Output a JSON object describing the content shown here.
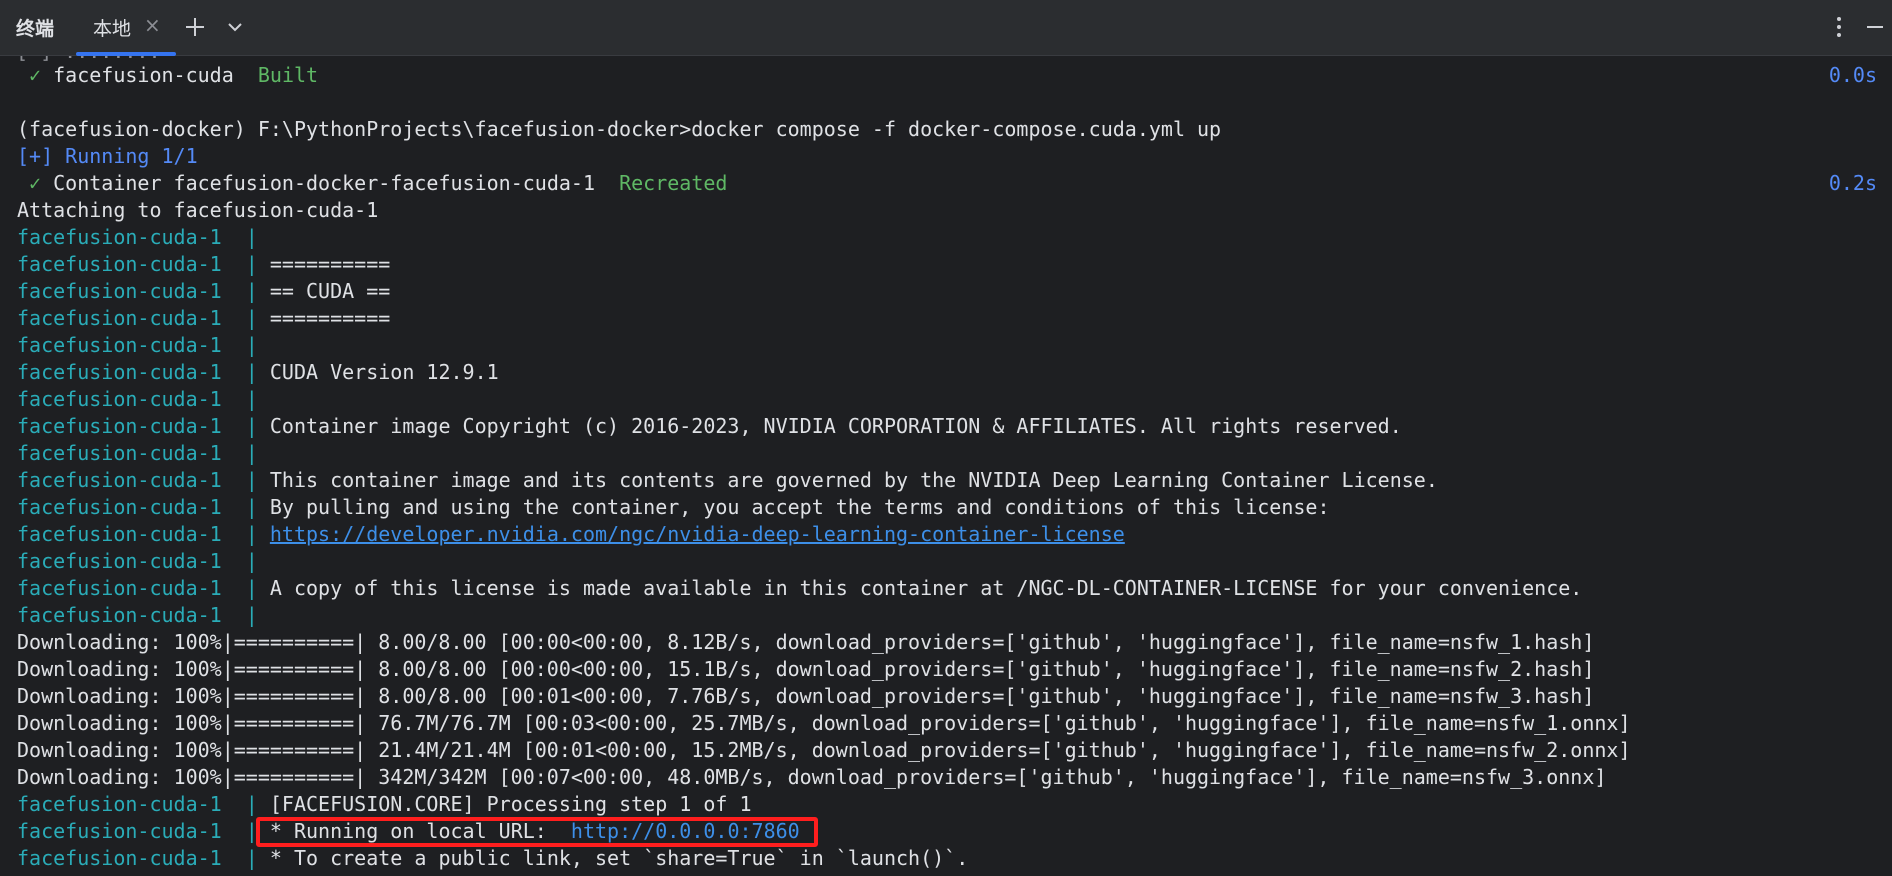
{
  "titlebar": {
    "panel_title": "终端",
    "tab_label": "本地",
    "tab_close": "×",
    "colors": {
      "accent": "#3574f0",
      "background": "#2b2d30"
    }
  },
  "terminal": {
    "cut_line": "[ ] ........ ",
    "built_line": {
      "check": "✓",
      "name": "facefusion-cuda",
      "status": "Built",
      "duration": "0.0s"
    },
    "blank1": "",
    "command": "(facefusion-docker) F:\\PythonProjects\\facefusion-docker>docker compose -f docker-compose.cuda.yml up",
    "running": "[+] Running 1/1",
    "recreated_line": {
      "check": "✓",
      "name": "Container facefusion-docker-facefusion-cuda-1",
      "status": "Recreated",
      "duration": "0.2s"
    },
    "attaching": "Attaching to facefusion-cuda-1",
    "prefix": "facefusion-cuda-1  | ",
    "log": [
      "",
      "==========",
      "== CUDA ==",
      "==========",
      "",
      "CUDA Version 12.9.1",
      "",
      "Container image Copyright (c) 2016-2023, NVIDIA CORPORATION & AFFILIATES. All rights reserved.",
      "",
      "This container image and its contents are governed by the NVIDIA Deep Learning Container License.",
      "By pulling and using the container, you accept the terms and conditions of this license:",
      "https://developer.nvidia.com/ngc/nvidia-deep-learning-container-license",
      "",
      "A copy of this license is made available in this container at /NGC-DL-CONTAINER-LICENSE for your convenience.",
      ""
    ],
    "downloads": [
      "Downloading: 100%|==========| 8.00/8.00 [00:00<00:00, 8.12B/s, download_providers=['github', 'huggingface'], file_name=nsfw_1.hash]",
      "Downloading: 100%|==========| 8.00/8.00 [00:00<00:00, 15.1B/s, download_providers=['github', 'huggingface'], file_name=nsfw_2.hash]",
      "Downloading: 100%|==========| 8.00/8.00 [00:01<00:00, 7.76B/s, download_providers=['github', 'huggingface'], file_name=nsfw_3.hash]",
      "Downloading: 100%|==========| 76.7M/76.7M [00:03<00:00, 25.7MB/s, download_providers=['github', 'huggingface'], file_name=nsfw_1.onnx]",
      "Downloading: 100%|==========| 21.4M/21.4M [00:01<00:00, 15.2MB/s, download_providers=['github', 'huggingface'], file_name=nsfw_2.onnx]",
      "Downloading: 100%|==========| 342M/342M [00:07<00:00, 48.0MB/s, download_providers=['github', 'huggingface'], file_name=nsfw_3.onnx]"
    ],
    "core_step": "[FACEFUSION.CORE] Processing step 1 of 1",
    "local_url_text": "* Running on local URL:  ",
    "local_url": "http://0.0.0.0:7860",
    "public_link": "* To create a public link, set `share=True` in `launch()`.",
    "colors": {
      "prefix": "#2aacb8",
      "green": "#5fb865",
      "blue": "#548af7",
      "link": "#3d8fe8",
      "highlight": "#ff1e1e"
    }
  }
}
